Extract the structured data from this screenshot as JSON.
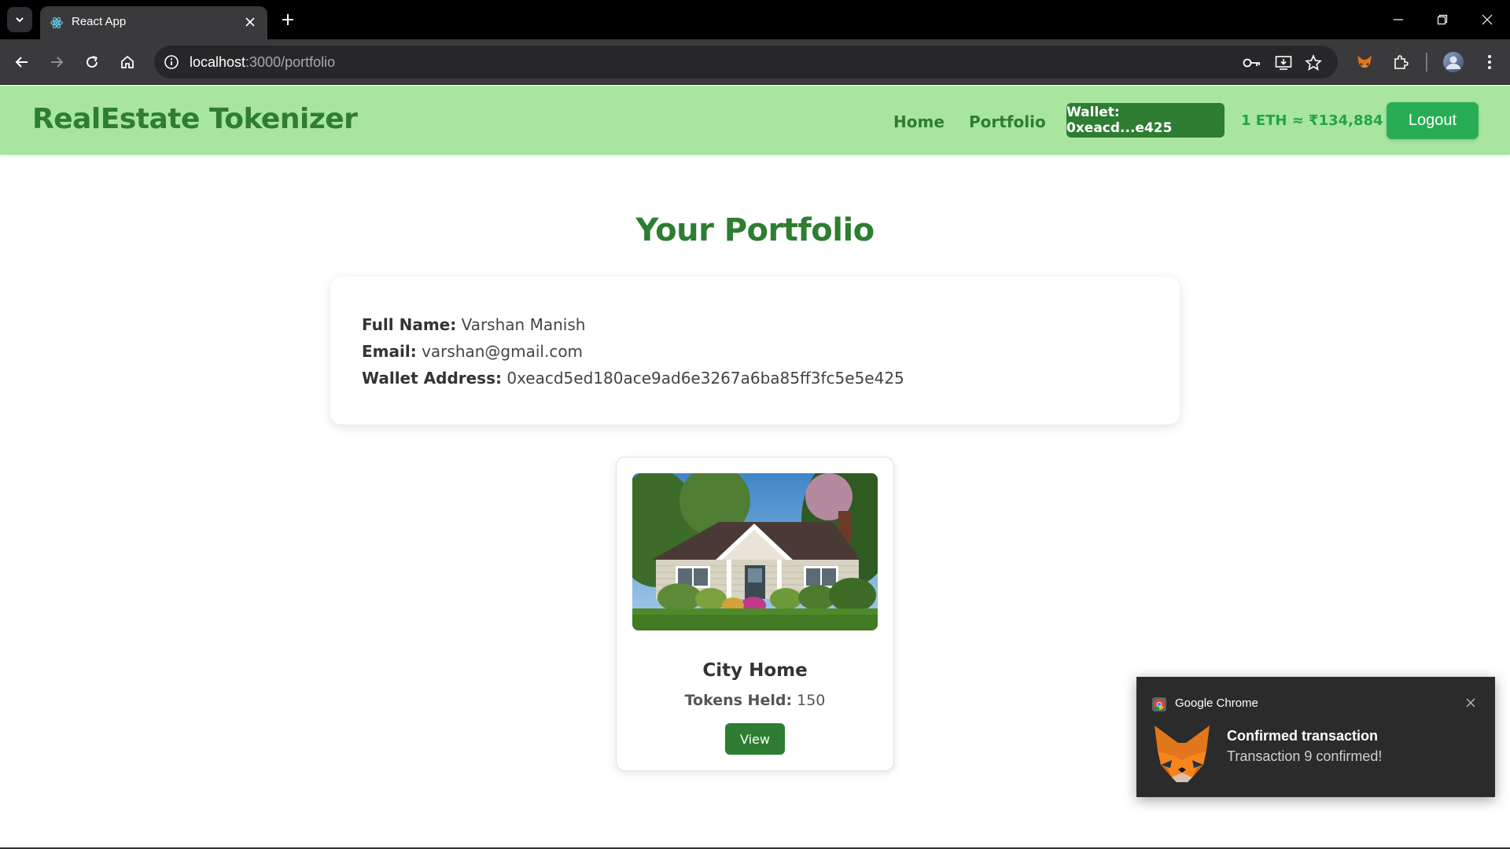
{
  "browser": {
    "tab": {
      "title": "React App",
      "favicon": "react-icon"
    },
    "url": {
      "host": "localhost",
      "path": ":3000/portfolio"
    }
  },
  "navbar": {
    "brand": "RealEstate Tokenizer",
    "links": [
      "Home",
      "Portfolio"
    ],
    "wallet": "Wallet: 0xeacd...e425",
    "eth_rate": "1 ETH ≈ ₹134,884",
    "logout": "Logout"
  },
  "page": {
    "title": "Your Portfolio"
  },
  "profile": {
    "full_name_label": "Full Name:",
    "full_name": "Varshan Manish",
    "email_label": "Email:",
    "email": "varshan@gmail.com",
    "wallet_label": "Wallet Address:",
    "wallet_address": "0xeacd5ed180ace9ad6e3267a6ba85ff3fc5e5e425"
  },
  "properties": [
    {
      "name": "City Home",
      "tokens_label": "Tokens Held:",
      "tokens": "150",
      "view_label": "View"
    }
  ],
  "notification": {
    "app": "Google Chrome",
    "title": "Confirmed transaction",
    "body": "Transaction 9 confirmed!",
    "icon": "metamask-fox-icon"
  },
  "colors": {
    "navbar_bg": "#a8e6a0",
    "brand_green": "#2e7d32",
    "accent_green": "#27ae54"
  }
}
